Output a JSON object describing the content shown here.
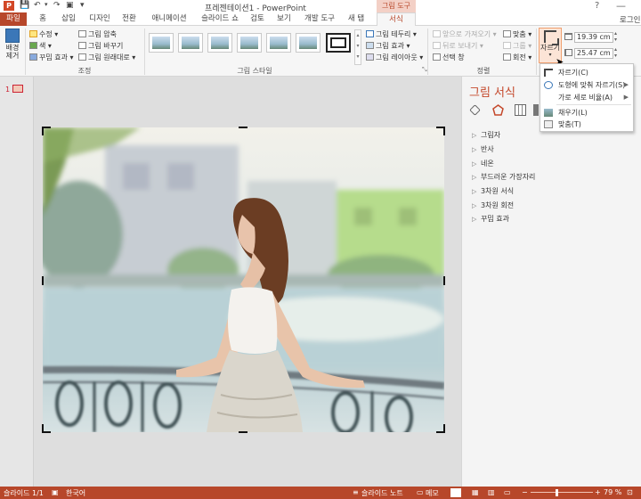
{
  "titlebar": {
    "app_icon": "P",
    "window_title": "프레젠테이션1 - PowerPoint",
    "tools_tab": "그림 도구",
    "help": "?",
    "minimize": "—"
  },
  "tabs": [
    "파일",
    "홈",
    "삽입",
    "디자인",
    "전환",
    "애니메이션",
    "슬라이드 쇼",
    "검토",
    "보기",
    "개발 도구",
    "새 탭",
    "서식"
  ],
  "user": "로그인",
  "ribbon": {
    "remove_bg": "배경\n제거",
    "adjust": {
      "corrections": "수정",
      "color": "색",
      "artistic": "꾸밈 효과",
      "compress": "그림 압축",
      "change": "그림 바꾸기",
      "reset": "그림 원래대로",
      "label": "조정"
    },
    "styles": {
      "label": "그림 스타일"
    },
    "pic_opts": {
      "border": "그림 테두리",
      "effects": "그림 효과",
      "layout": "그림 레이아웃"
    },
    "arrange": {
      "bring_forward": "앞으로 가져오기",
      "send_backward": "뒤로 보내기",
      "selection_pane": "선택 창",
      "align": "맞춤",
      "group": "그룹",
      "rotate": "회전",
      "label": "정렬"
    },
    "size": {
      "crop": "자르기",
      "height": "19.39 cm",
      "width": "25.47 cm"
    }
  },
  "crop_menu": {
    "items": [
      "자르기(C)",
      "도형에 맞춰 자르기(S)",
      "가로 세로 비율(A)",
      "채우기(L)",
      "맞춤(T)"
    ]
  },
  "slides": {
    "number": "1"
  },
  "format_pane": {
    "title": "그림 서식",
    "sections": [
      "그림자",
      "반사",
      "네온",
      "부드러운 가장자리",
      "3차원 서식",
      "3차원 회전",
      "꾸밈 효과"
    ]
  },
  "status": {
    "slide_info": "슬라이드 1/1",
    "language": "한국어",
    "notes": "슬라이드 노트",
    "memo": "메모",
    "zoom": "79 %"
  },
  "colors": {
    "accent": "#b7472a",
    "tools_tab_bg": "#f3d0c6"
  }
}
